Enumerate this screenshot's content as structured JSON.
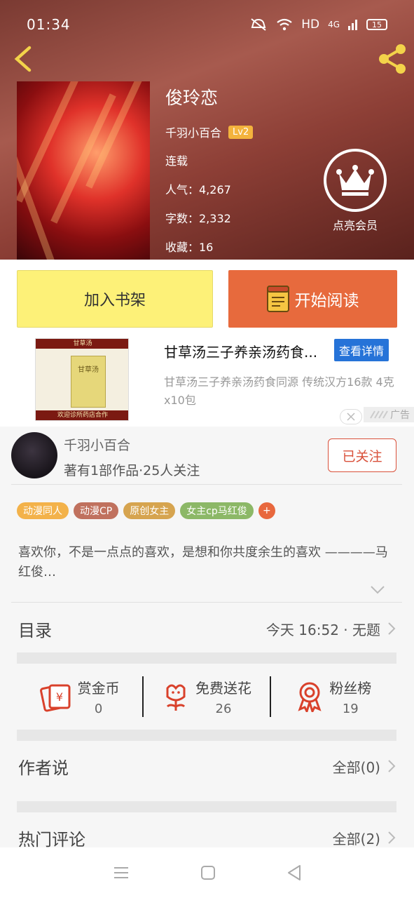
{
  "status_bar": {
    "time": "01:34",
    "network": "HD",
    "signal": "4G",
    "battery": "15"
  },
  "book": {
    "title": "俊玲恋",
    "author": "千羽小百合",
    "author_level": "Lv2",
    "status": "连载",
    "popularity": "人气：4,267",
    "word_count": "字数：2,332",
    "favorites": "收藏：16"
  },
  "vip": {
    "label": "点亮会员"
  },
  "actions": {
    "add_shelf": "加入书架",
    "start_reading": "开始阅读"
  },
  "ad": {
    "image_top_text": "甘草汤",
    "image_box_text": "甘草汤",
    "image_bottom_text": "欢迎诊所药店合作",
    "title": "甘草汤三子养亲汤药食...",
    "detail_button": "查看详情",
    "description": "甘草汤三子养亲汤药食同源 传统汉方16款  4克x10包",
    "tag": "广告"
  },
  "author_card": {
    "name": "千羽小百合",
    "meta": "著有1部作品·25人关注",
    "follow_label": "已关注"
  },
  "tags": [
    {
      "label": "动漫同人",
      "color": "#f3b24a"
    },
    {
      "label": "动漫CP",
      "color": "#c0715e"
    },
    {
      "label": "原创女主",
      "color": "#d6a44f"
    },
    {
      "label": "女主cp马红俊",
      "color": "#8cb867"
    },
    {
      "label": "+",
      "color": "#e8683e"
    }
  ],
  "description": "喜欢你，不是一点点的喜欢，是想和你共度余生的喜欢 ————马红俊…",
  "catalog": {
    "title": "目录",
    "latest": "今天 16:52 · 无题"
  },
  "stats": {
    "reward": {
      "label": "赏金币",
      "value": "0"
    },
    "flowers": {
      "label": "免费送花",
      "value": "26"
    },
    "fans": {
      "label": "粉丝榜",
      "value": "19"
    }
  },
  "author_says": {
    "title": "作者说",
    "count": "全部(0)"
  },
  "hot_comments": {
    "title": "热门评论",
    "count": "全部(2)"
  },
  "colors": {
    "accent": "#e76a3d",
    "shelf": "#fdf178",
    "follow": "#d9503a",
    "icon_red": "#d9412b"
  }
}
